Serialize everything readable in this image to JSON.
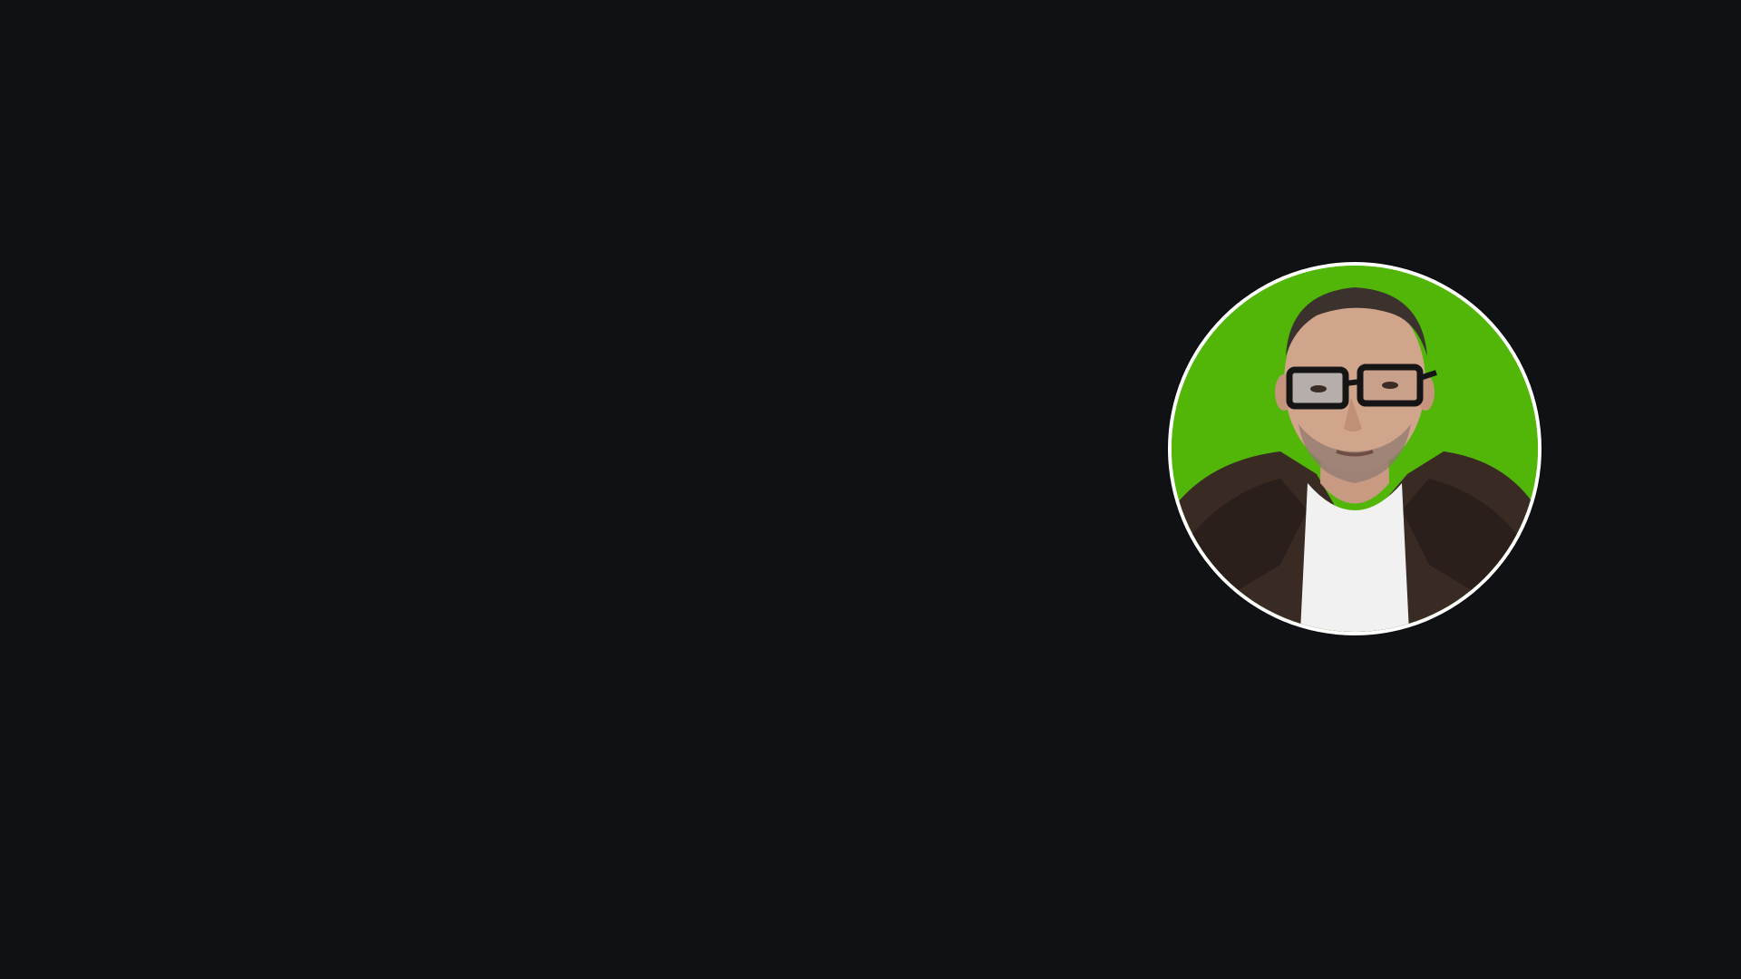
{
  "avatar": {
    "icon": "user-photo-avatar",
    "background_color": "#52b609",
    "ring_color": "#ffffff",
    "page_background": "#101114"
  }
}
